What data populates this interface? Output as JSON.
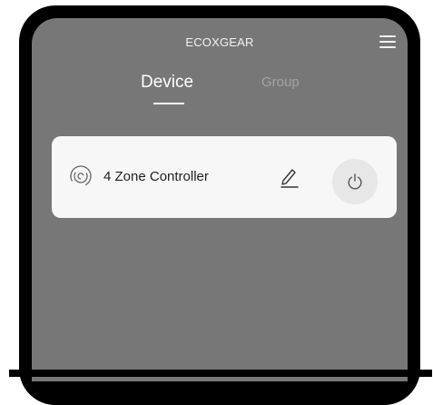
{
  "header": {
    "title": "ECOXGEAR",
    "menu_icon": "hamburger-menu-icon"
  },
  "tabs": {
    "device_label": "Device",
    "group_label": "Group",
    "active": "Device"
  },
  "devices": [
    {
      "name": "4 Zone Controller",
      "icon": "spiral-swirl-icon",
      "edit_icon": "pencil-edit-icon",
      "power_icon": "power-icon"
    }
  ],
  "colors": {
    "screen_background": "#777777",
    "card_background": "#f7f7f7",
    "power_button_background": "#e7e7e7",
    "active_tab": "#ffffff",
    "inactive_tab": "#a4a4a4"
  }
}
